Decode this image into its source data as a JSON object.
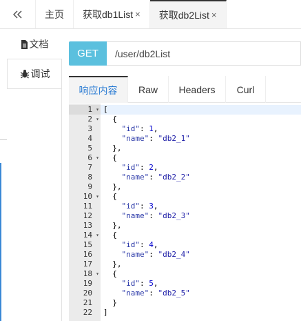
{
  "topbar": {
    "collapse_icon": "double-chevron-left-icon",
    "tabs": [
      {
        "label": "主页",
        "closable": false
      },
      {
        "label": "获取db1List",
        "closable": true
      },
      {
        "label": "获取db2List",
        "closable": true,
        "active": true
      }
    ],
    "close_glyph": "×"
  },
  "sidebar": {
    "doc_label": "文档",
    "debug_label": "调试"
  },
  "request": {
    "method": "GET",
    "url": "/user/db2List"
  },
  "response_tabs": [
    "响应内容",
    "Raw",
    "Headers",
    "Curl"
  ],
  "editor": {
    "lines": [
      {
        "n": "1",
        "fold": true,
        "text": "["
      },
      {
        "n": "2",
        "fold": true,
        "text": "  {"
      },
      {
        "n": "3",
        "fold": false,
        "key": "\"id\"",
        "val": "1",
        "type": "num",
        "comma": true
      },
      {
        "n": "4",
        "fold": false,
        "key": "\"name\"",
        "val": "\"db2_1\"",
        "type": "str",
        "comma": false
      },
      {
        "n": "5",
        "fold": false,
        "text": "  },"
      },
      {
        "n": "6",
        "fold": true,
        "text": "  {"
      },
      {
        "n": "7",
        "fold": false,
        "key": "\"id\"",
        "val": "2",
        "type": "num",
        "comma": true
      },
      {
        "n": "8",
        "fold": false,
        "key": "\"name\"",
        "val": "\"db2_2\"",
        "type": "str",
        "comma": false
      },
      {
        "n": "9",
        "fold": false,
        "text": "  },"
      },
      {
        "n": "10",
        "fold": true,
        "text": "  {"
      },
      {
        "n": "11",
        "fold": false,
        "key": "\"id\"",
        "val": "3",
        "type": "num",
        "comma": true
      },
      {
        "n": "12",
        "fold": false,
        "key": "\"name\"",
        "val": "\"db2_3\"",
        "type": "str",
        "comma": false
      },
      {
        "n": "13",
        "fold": false,
        "text": "  },"
      },
      {
        "n": "14",
        "fold": true,
        "text": "  {"
      },
      {
        "n": "15",
        "fold": false,
        "key": "\"id\"",
        "val": "4",
        "type": "num",
        "comma": true
      },
      {
        "n": "16",
        "fold": false,
        "key": "\"name\"",
        "val": "\"db2_4\"",
        "type": "str",
        "comma": false
      },
      {
        "n": "17",
        "fold": false,
        "text": "  },"
      },
      {
        "n": "18",
        "fold": true,
        "text": "  {"
      },
      {
        "n": "19",
        "fold": false,
        "key": "\"id\"",
        "val": "5",
        "type": "num",
        "comma": true
      },
      {
        "n": "20",
        "fold": false,
        "key": "\"name\"",
        "val": "\"db2_5\"",
        "type": "str",
        "comma": false
      },
      {
        "n": "21",
        "fold": false,
        "text": "  }"
      },
      {
        "n": "22",
        "fold": false,
        "text": "]"
      }
    ]
  },
  "colors": {
    "method_bg": "#5bc0de",
    "active_tab_text": "#2a7bd3",
    "json_key": "#2a38a8",
    "json_string": "#1a1aa6",
    "json_number": "#0000cd"
  }
}
